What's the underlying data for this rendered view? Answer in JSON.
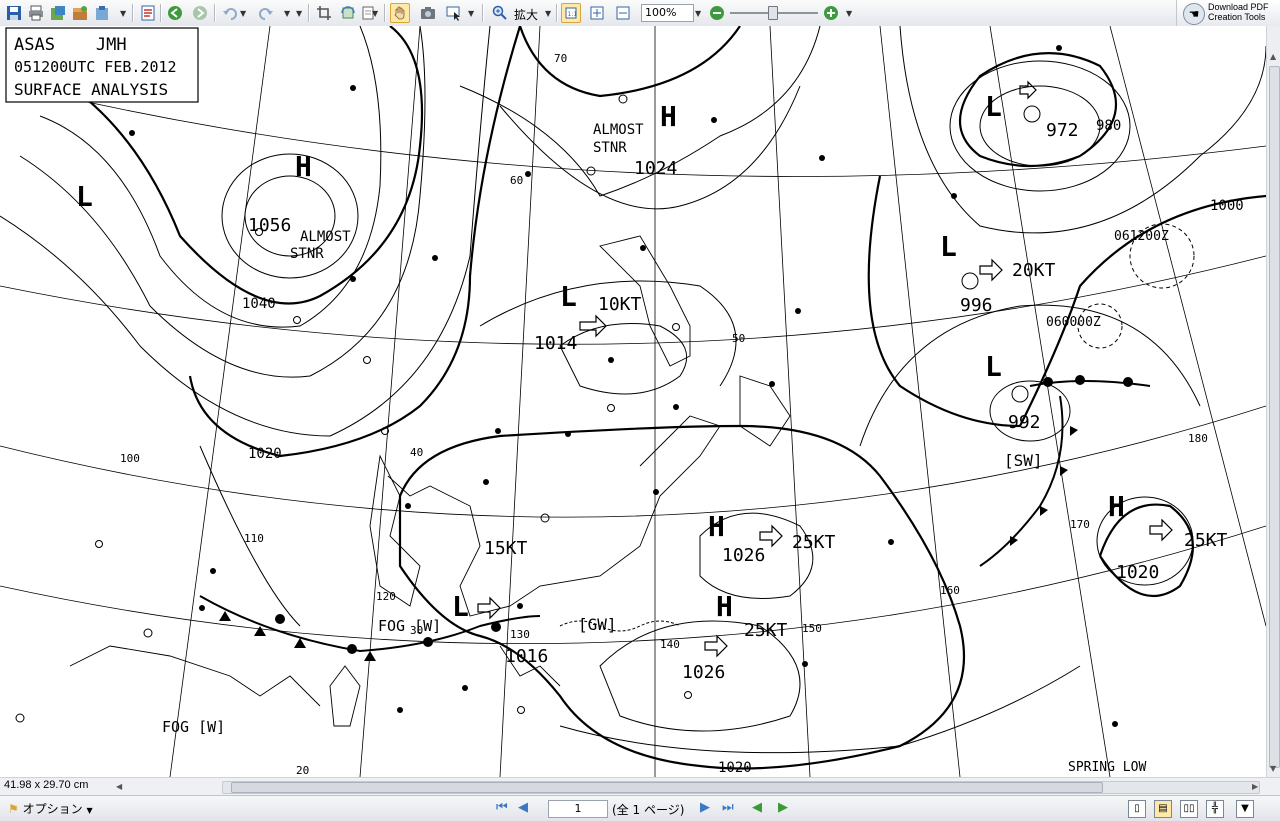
{
  "toolbar": {
    "zoom_label": "拡大",
    "zoom_value": "100%"
  },
  "download": {
    "line1": "Download PDF",
    "line2": "Creation Tools"
  },
  "map": {
    "title_lines": [
      "ASAS    JMH",
      "051200UTC FEB.2012",
      "SURFACE ANALYSIS"
    ],
    "labels": {
      "h_1056": "1056",
      "almost_stnr_1": "ALMOST",
      "almost_stnr_2": "STNR",
      "h_1024": "1024",
      "almost_stnr_3": "ALMOST",
      "almost_stnr_4": "STNR",
      "l_1014": "1014",
      "kt_10": "10KT",
      "l_996": "996",
      "kt_20": "20KT",
      "l_972": "972",
      "l_992": "992",
      "sw": "[SW]",
      "h_1026a": "1026",
      "kt_25a": "25KT",
      "h_1026b": "1026",
      "kt_25b": "25KT",
      "h_1020": "1020",
      "kt_25c": "25KT",
      "kt_15": "15KT",
      "l_1016": "1016",
      "gw": "[GW]",
      "fog_w1": "FOG [W]",
      "fog_w2": "FOG [W]",
      "spring_low": "SPRING LOW",
      "iso_1040": "1040",
      "iso_1020a": "1020",
      "iso_1020b": "1020",
      "iso_1000": "1000",
      "iso_980": "980",
      "t_060000z": "060000Z",
      "t_061200z": "061200Z",
      "iso_100": "100",
      "iso_110": "110",
      "iso_120": "120",
      "iso_130": "130",
      "iso_140": "140",
      "iso_150": "150",
      "iso_160": "160",
      "iso_170": "170",
      "iso_180": "180",
      "iso_50": "50",
      "iso_60": "60",
      "iso_70": "70",
      "iso_20": "20",
      "iso_30": "30",
      "iso_40": "40"
    }
  },
  "dims": "41.98 x 29.70 cm",
  "status": {
    "options_label": "オプション",
    "page_number": "1",
    "page_total": "(全 1 ページ)"
  }
}
